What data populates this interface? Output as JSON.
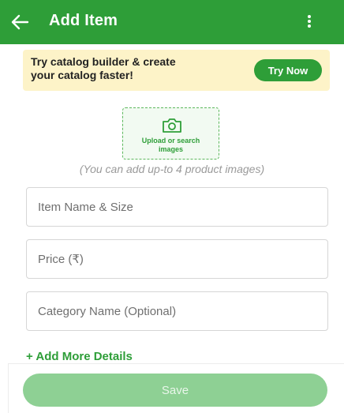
{
  "appbar": {
    "title": "Add Item",
    "back_icon": "arrow-left-icon",
    "menu_icon": "more-vertical-icon"
  },
  "banner": {
    "text": "Try catalog builder & create\nyour catalog faster!",
    "button_label": "Try Now"
  },
  "upload": {
    "icon": "camera-icon",
    "label": "Upload or search\nimages",
    "hint": "(You can add up-to 4 product images)"
  },
  "form": {
    "item_name_placeholder": "Item Name & Size",
    "price_placeholder": "Price (₹)",
    "category_placeholder": "Category Name (Optional)",
    "add_more_label": "+ Add More Details"
  },
  "footer": {
    "save_label": "Save"
  },
  "colors": {
    "brand_green": "#2e9e38",
    "banner_bg": "#fdf3c8",
    "save_disabled": "#8ed094"
  }
}
